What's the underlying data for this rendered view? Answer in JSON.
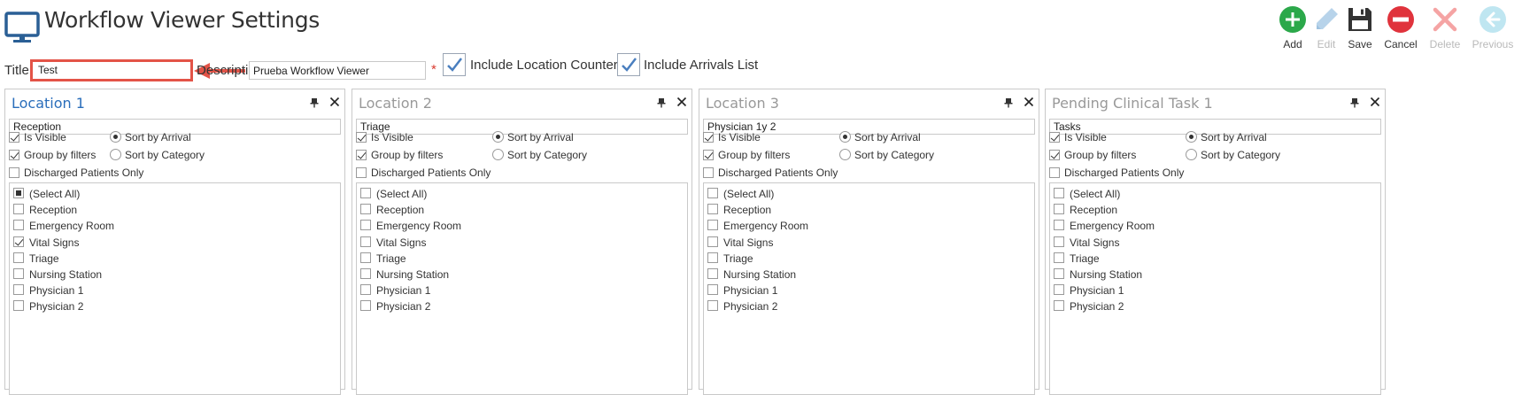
{
  "header": {
    "title": "Workflow Viewer Settings"
  },
  "toolbar": [
    {
      "name": "add",
      "label": "Add",
      "icon": "add-icon",
      "enabled": true,
      "color": "#2ba84a"
    },
    {
      "name": "edit",
      "label": "Edit",
      "icon": "pencil-icon",
      "enabled": false,
      "color": "#b7d3ea"
    },
    {
      "name": "save",
      "label": "Save",
      "icon": "floppy-disk-icon",
      "enabled": true,
      "color": "#333333"
    },
    {
      "name": "cancel",
      "label": "Cancel",
      "icon": "cancel-icon",
      "enabled": true,
      "color": "#e0333c"
    },
    {
      "name": "delete",
      "label": "Delete",
      "icon": "close-x-icon",
      "enabled": false,
      "color": "#f5a4a4"
    },
    {
      "name": "previous",
      "label": "Previous",
      "icon": "arrow-left-icon",
      "enabled": false,
      "color": "#bfe6f1"
    }
  ],
  "form": {
    "title_label": "Title:",
    "title_value": "Test",
    "description_label": "Description:",
    "description_value": "Prueba Workflow Viewer",
    "required_marker": "*",
    "include_location_counters_label": "Include Location Counters",
    "include_location_counters": true,
    "include_arrivals_list_label": "Include Arrivals List",
    "include_arrivals_list": true
  },
  "panel_labels": {
    "is_visible": "Is Visible",
    "group_by_filters": "Group by filters",
    "discharged_only": "Discharged Patients Only",
    "sort_by_arrival": "Sort by Arrival",
    "sort_by_category": "Sort by Category"
  },
  "panels": [
    {
      "title": "Location 1",
      "name_value": "Reception",
      "active": true,
      "is_visible": true,
      "group_by_filters": true,
      "discharged_only": false,
      "sort": "arrival",
      "items": [
        {
          "label": "(Select All)",
          "state": "indeterminate"
        },
        {
          "label": "Reception",
          "state": "unchecked"
        },
        {
          "label": "Emergency Room",
          "state": "unchecked"
        },
        {
          "label": "Vital Signs",
          "state": "checked"
        },
        {
          "label": "Triage",
          "state": "unchecked"
        },
        {
          "label": "Nursing Station",
          "state": "unchecked"
        },
        {
          "label": "Physician 1",
          "state": "unchecked"
        },
        {
          "label": "Physician 2",
          "state": "unchecked"
        }
      ]
    },
    {
      "title": "Location 2",
      "name_value": "Triage",
      "active": false,
      "is_visible": true,
      "group_by_filters": true,
      "discharged_only": false,
      "sort": "arrival",
      "items": [
        {
          "label": "(Select All)",
          "state": "unchecked"
        },
        {
          "label": "Reception",
          "state": "unchecked"
        },
        {
          "label": "Emergency Room",
          "state": "unchecked"
        },
        {
          "label": "Vital Signs",
          "state": "unchecked"
        },
        {
          "label": "Triage",
          "state": "unchecked"
        },
        {
          "label": "Nursing Station",
          "state": "unchecked"
        },
        {
          "label": "Physician 1",
          "state": "unchecked"
        },
        {
          "label": "Physician 2",
          "state": "unchecked"
        }
      ]
    },
    {
      "title": "Location 3",
      "name_value": "Physician 1y 2",
      "active": false,
      "is_visible": true,
      "group_by_filters": true,
      "discharged_only": false,
      "sort": "arrival",
      "items": [
        {
          "label": "(Select All)",
          "state": "unchecked"
        },
        {
          "label": "Reception",
          "state": "unchecked"
        },
        {
          "label": "Emergency Room",
          "state": "unchecked"
        },
        {
          "label": "Vital Signs",
          "state": "unchecked"
        },
        {
          "label": "Triage",
          "state": "unchecked"
        },
        {
          "label": "Nursing Station",
          "state": "unchecked"
        },
        {
          "label": "Physician 1",
          "state": "unchecked"
        },
        {
          "label": "Physician 2",
          "state": "unchecked"
        }
      ]
    },
    {
      "title": "Pending Clinical Task 1",
      "name_value": "Tasks",
      "active": false,
      "is_visible": true,
      "group_by_filters": true,
      "discharged_only": false,
      "sort": "arrival",
      "items": [
        {
          "label": "(Select All)",
          "state": "unchecked"
        },
        {
          "label": "Reception",
          "state": "unchecked"
        },
        {
          "label": "Emergency Room",
          "state": "unchecked"
        },
        {
          "label": "Vital Signs",
          "state": "unchecked"
        },
        {
          "label": "Triage",
          "state": "unchecked"
        },
        {
          "label": "Nursing Station",
          "state": "unchecked"
        },
        {
          "label": "Physician 1",
          "state": "unchecked"
        },
        {
          "label": "Physician 2",
          "state": "unchecked"
        }
      ]
    }
  ],
  "colors": {
    "accent_blue": "#2a6ebb",
    "highlight_red": "#e35347",
    "monitor_icon": "#2a5f95"
  }
}
